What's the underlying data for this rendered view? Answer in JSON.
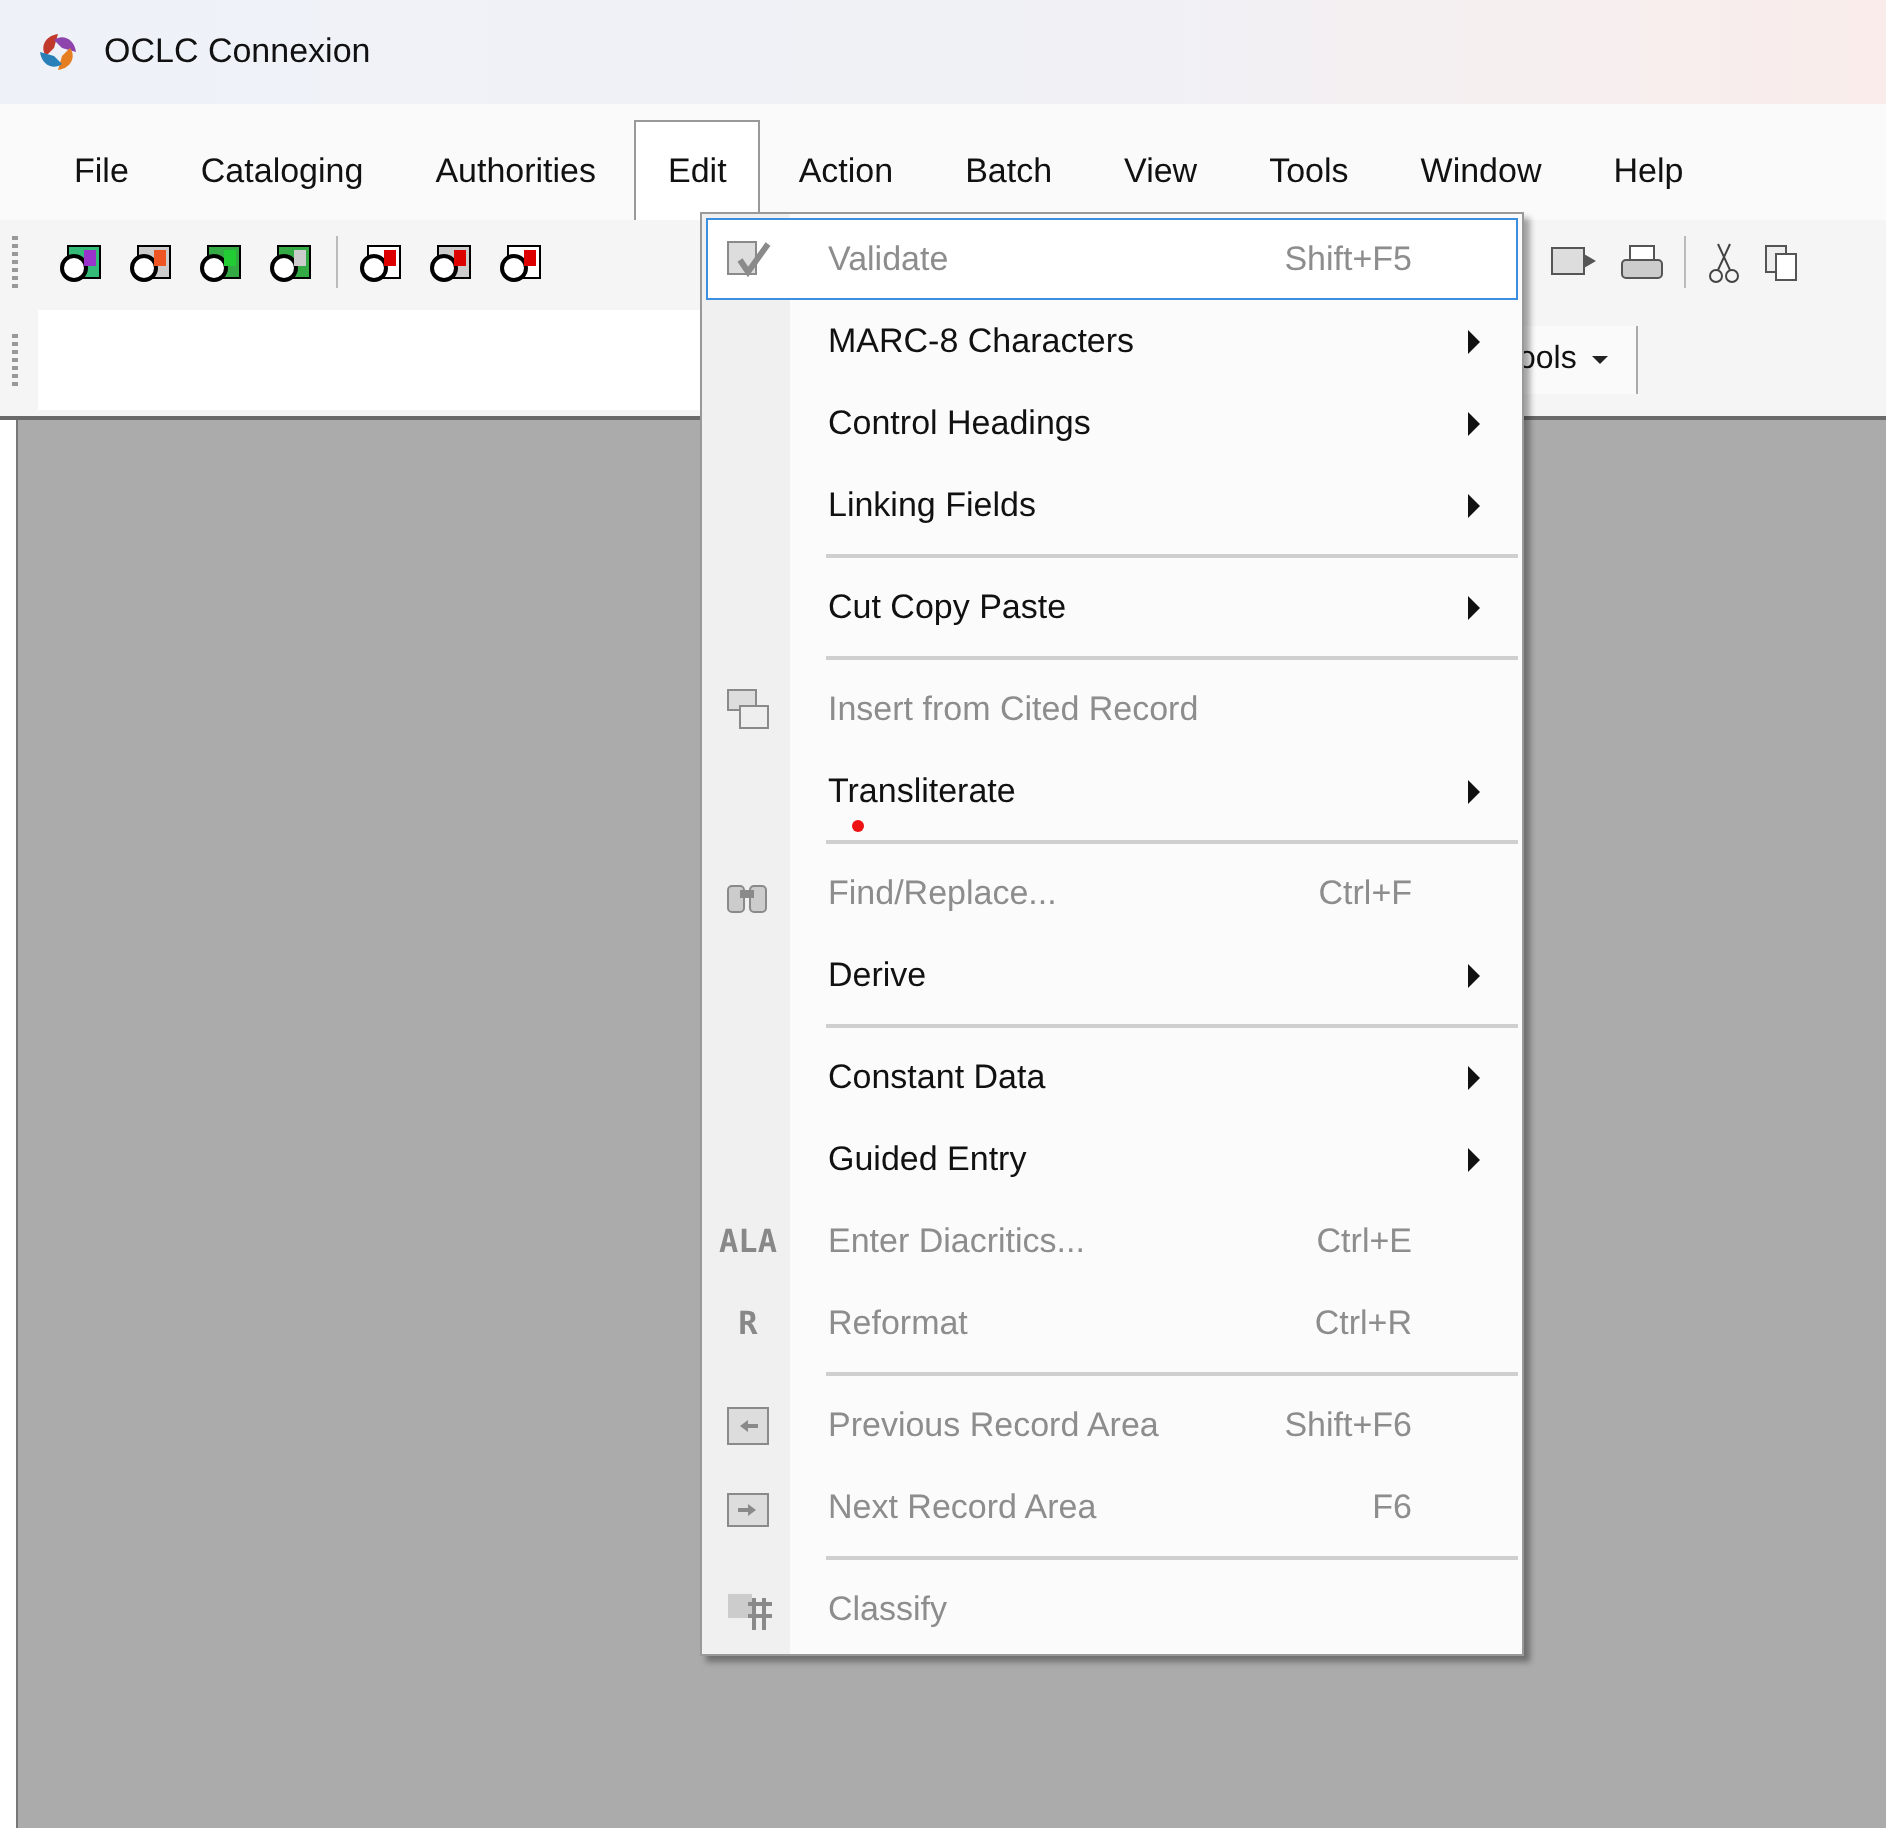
{
  "window": {
    "title": "OCLC Connexion"
  },
  "menubar": [
    {
      "label": "File",
      "selected": false
    },
    {
      "label": "Cataloging",
      "selected": false
    },
    {
      "label": "Authorities",
      "selected": false
    },
    {
      "label": "Edit",
      "selected": true
    },
    {
      "label": "Action",
      "selected": false
    },
    {
      "label": "Batch",
      "selected": false
    },
    {
      "label": "View",
      "selected": false
    },
    {
      "label": "Tools",
      "selected": false
    },
    {
      "label": "Window",
      "selected": false
    },
    {
      "label": "Help",
      "selected": false
    }
  ],
  "toolbar2": {
    "dropdown": "ools"
  },
  "edit_menu": [
    {
      "kind": "item",
      "label": "Validate",
      "shortcut": "Shift+F5",
      "submenu": false,
      "disabled": true,
      "selected": true,
      "marker": false
    },
    {
      "kind": "item",
      "label": "MARC-8 Characters",
      "submenu": true,
      "disabled": false,
      "selected": false,
      "marker": false
    },
    {
      "kind": "item",
      "label": "Control Headings",
      "submenu": true,
      "disabled": false,
      "selected": false,
      "marker": false
    },
    {
      "kind": "item",
      "label": "Linking Fields",
      "submenu": true,
      "disabled": false,
      "selected": false,
      "marker": false
    },
    {
      "kind": "separator"
    },
    {
      "kind": "item",
      "label": "Cut Copy Paste",
      "submenu": true,
      "disabled": false,
      "selected": false,
      "marker": false
    },
    {
      "kind": "separator"
    },
    {
      "kind": "item",
      "label": "Insert from Cited Record",
      "submenu": false,
      "disabled": true,
      "selected": false,
      "marker": false
    },
    {
      "kind": "item",
      "label": "Transliterate",
      "submenu": true,
      "disabled": false,
      "selected": false,
      "marker": true
    },
    {
      "kind": "separator"
    },
    {
      "kind": "item",
      "label": "Find/Replace...",
      "shortcut": "Ctrl+F",
      "submenu": false,
      "disabled": true,
      "selected": false,
      "marker": false
    },
    {
      "kind": "item",
      "label": "Derive",
      "submenu": true,
      "disabled": false,
      "selected": false,
      "marker": false
    },
    {
      "kind": "separator"
    },
    {
      "kind": "item",
      "label": "Constant Data",
      "submenu": true,
      "disabled": false,
      "selected": false,
      "marker": false
    },
    {
      "kind": "item",
      "label": "Guided Entry",
      "submenu": true,
      "disabled": false,
      "selected": false,
      "marker": false
    },
    {
      "kind": "item",
      "label": "Enter Diacritics...",
      "shortcut": "Ctrl+E",
      "icon_text": "ALA",
      "submenu": false,
      "disabled": true,
      "selected": false,
      "marker": false
    },
    {
      "kind": "item",
      "label": "Reformat",
      "shortcut": "Ctrl+R",
      "icon_text": "R",
      "submenu": false,
      "disabled": true,
      "selected": false,
      "marker": false
    },
    {
      "kind": "separator"
    },
    {
      "kind": "item",
      "label": "Previous Record Area",
      "shortcut": "Shift+F6",
      "submenu": false,
      "disabled": true,
      "selected": false,
      "marker": false
    },
    {
      "kind": "item",
      "label": "Next Record Area",
      "shortcut": "F6",
      "submenu": false,
      "disabled": true,
      "selected": false,
      "marker": false
    },
    {
      "kind": "separator"
    },
    {
      "kind": "item",
      "label": "Classify",
      "submenu": false,
      "disabled": true,
      "selected": false,
      "marker": false
    }
  ]
}
